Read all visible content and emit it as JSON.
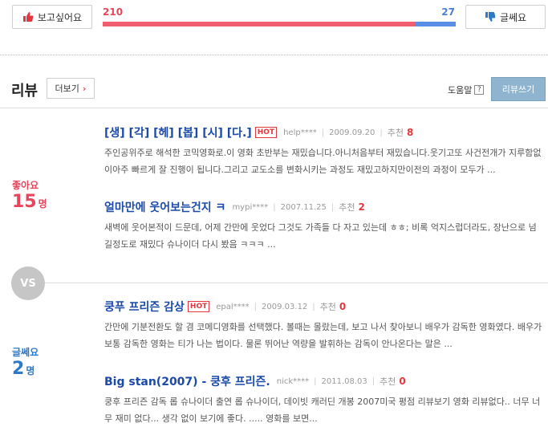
{
  "vote": {
    "like_label": "보고싶어요",
    "dislike_label": "글쎄요",
    "like_count": "210",
    "dislike_count": "27",
    "like_ratio": 0.886,
    "colors": {
      "like": "#f05e6f",
      "dislike": "#5b8ee6"
    }
  },
  "reviews": {
    "title": "리뷰",
    "more_label": "더보기",
    "help_label": "도움말",
    "help_icon": "?",
    "write_label": "리뷰쓰기"
  },
  "like_side": {
    "label": "좋아요",
    "count": "15",
    "unit": "명"
  },
  "dislike_side": {
    "label": "글쎄요",
    "count": "2",
    "unit": "명"
  },
  "vs_label": "VS",
  "items": [
    {
      "title": "[생] [각] [헤] [봅] [시] [다.]",
      "hot": "HOT",
      "user": "help****",
      "date": "2009.09.20",
      "rec_label": "추천",
      "rec": "8",
      "body": "주인공위주로 해석한 코믹영화로.이 영화 초반부는 재밌습니다.아니처음부터 재밌습니다.웃기고또 사건전개가 지루함없이아주 빠르게 잘 진행이 됩니다.그리고 교도소를 변화시키는 과정도 재밌고하지만이전의 과정이 모두가 ..."
    },
    {
      "title": "얼마만에 웃어보는건지 ㅋ",
      "hot": "",
      "user": "mypi****",
      "date": "2007.11.25",
      "rec_label": "추천",
      "rec": "2",
      "body": "새벽에 웃어본적이 드문데, 어제 간만에 웃었다 그것도 가족들 다 자고 있는데 ㅎㅎ; 비록 억지스럽더라도, 장난으로 넘길정도로 재밌다 슈나이더 다시 봤음 ㅋㅋㅋ ..."
    },
    {
      "title": "쿵푸 프리즌 감상",
      "hot": "HOT",
      "user": "epal****",
      "date": "2009.03.12",
      "rec_label": "추천",
      "rec": "0",
      "body": "간만에 기분전환도 할 겸 코메디영화를 선택했다. 볼때는 몰랐는데, 보고 나서 찾아보니 배우가 감독한 영화였다. 배우가 보통 감독한 영화는 티가 나는 법이다. 물론 뛰어난 역량을 발휘하는 감독이 안나온다는 말은 ..."
    },
    {
      "title": "Big stan(2007) - 쿵후 프리즌.",
      "hot": "",
      "user": "nick****",
      "date": "2011.08.03",
      "rec_label": "추천",
      "rec": "0",
      "body": "쿵후 프리즌 감독 롭 슈나이더 출연 롭 슈나이더, 데이빗 캐러딘 개봉 2007미국 평점 리뷰보기 영화 리뷰없다.. 너무 너무 재미 없다... 생각 없이 보기에 좋다. ..... 영화를 보면..."
    }
  ]
}
